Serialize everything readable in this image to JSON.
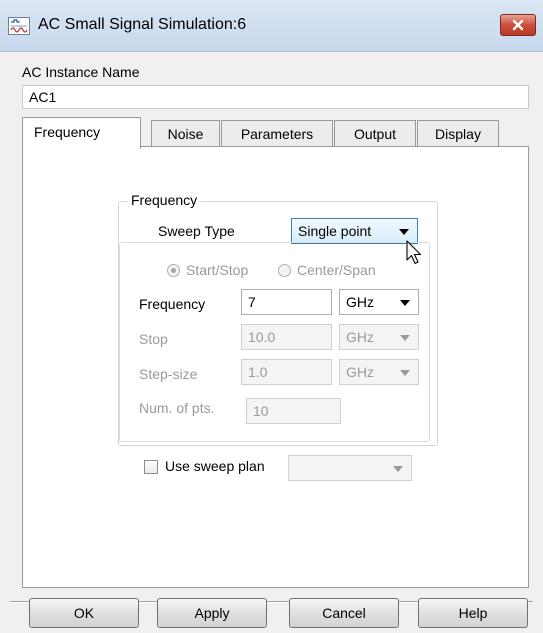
{
  "window": {
    "title": "AC Small Signal Simulation:6"
  },
  "instance": {
    "label": "AC Instance Name",
    "value": "AC1"
  },
  "tabs": [
    {
      "label": "Frequency",
      "active": true
    },
    {
      "label": "Noise",
      "active": false
    },
    {
      "label": "Parameters",
      "active": false
    },
    {
      "label": "Output",
      "active": false
    },
    {
      "label": "Display",
      "active": false
    }
  ],
  "frequency_group": {
    "title": "Frequency",
    "sweep_type_label": "Sweep Type",
    "sweep_type_value": "Single point",
    "radio_start_stop": "Start/Stop",
    "radio_center_span": "Center/Span",
    "radio_selected": "Start/Stop",
    "frequency_label": "Frequency",
    "frequency_value": "7",
    "frequency_unit": "GHz",
    "stop_label": "Stop",
    "stop_value": "10.0",
    "stop_unit": "GHz",
    "step_label": "Step-size",
    "step_value": "1.0",
    "step_unit": "GHz",
    "num_pts_label": "Num. of pts.",
    "num_pts_value": "10"
  },
  "sweep_plan": {
    "label": "Use sweep plan",
    "checked": false,
    "value": ""
  },
  "buttons": {
    "ok": "OK",
    "apply": "Apply",
    "cancel": "Cancel",
    "help": "Help"
  },
  "colors": {
    "titlebar": "#c7d8ed",
    "close_button": "#c9503c",
    "highlight_border": "#3c7fb1",
    "disabled_text": "#9a9a9a"
  },
  "icons": [
    "app-icon",
    "close-icon",
    "chevron-down-icon",
    "mouse-cursor-icon"
  ]
}
